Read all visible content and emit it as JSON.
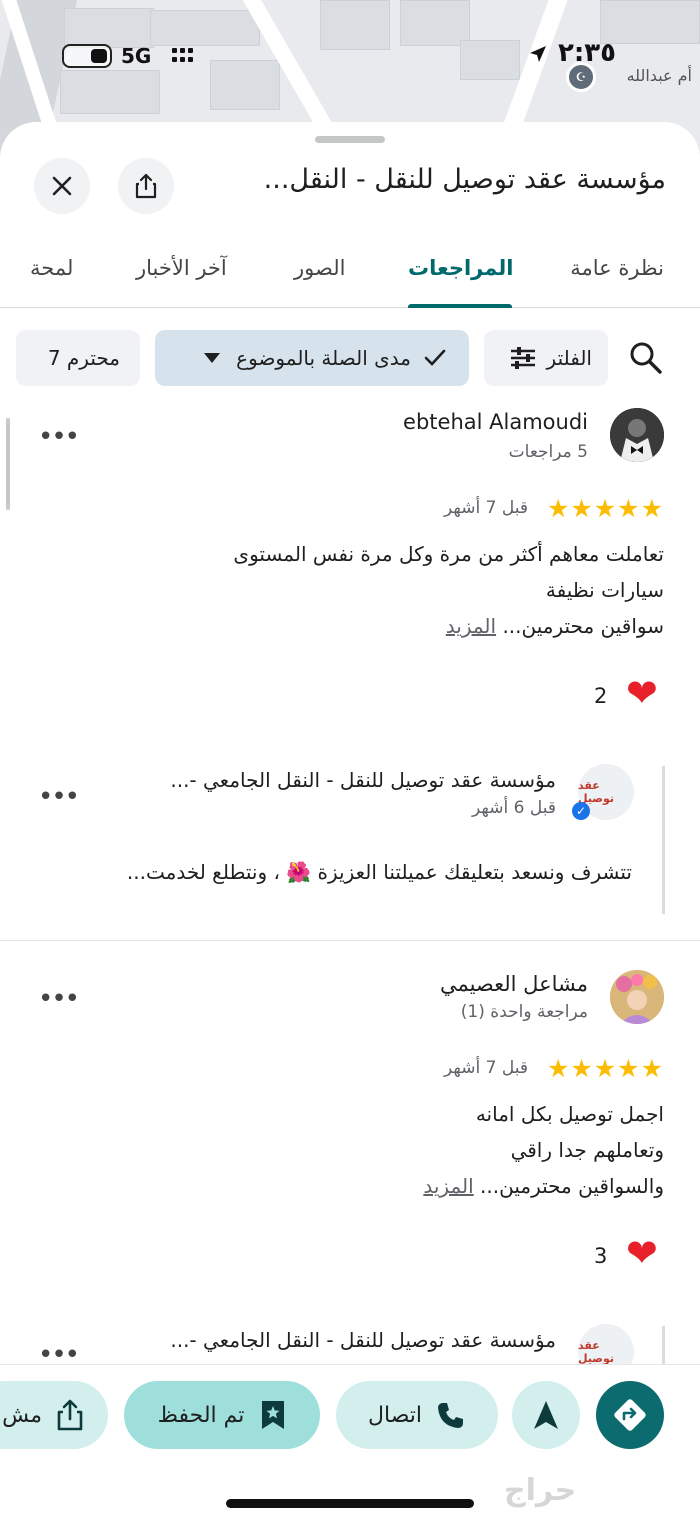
{
  "status_bar": {
    "time": "٢:٣٥",
    "network": "5G"
  },
  "map": {
    "label": "أم عبدالله"
  },
  "place": {
    "title": "مؤسسة عقد توصيل للنقل - النقل..."
  },
  "tabs": [
    {
      "label": "نظرة عامة"
    },
    {
      "label": "المراجعات"
    },
    {
      "label": "الصور"
    },
    {
      "label": "آخر الأخبار"
    },
    {
      "label": "لمحة"
    }
  ],
  "filters": {
    "filter_label": "الفلتر",
    "sort_label": "مدى الصلة بالموضوع",
    "topic_chip": "محترم 7"
  },
  "reviews": [
    {
      "author": "ebtehal Alamoudi",
      "author_meta": "5 مراجعات",
      "rating": 5,
      "stars": "★★★★★",
      "when": "قبل 7 أشهر",
      "lines": [
        "تعاملت معاهم أكثر من مرة وكل مرة نفس المستوى",
        "سيارات نظيفة",
        "سواقين محترمين..."
      ],
      "more_label": "المزيد",
      "likes": "2",
      "owner": {
        "name": "مؤسسة عقد توصيل للنقل - النقل الجامعي -...",
        "when": "قبل 6 أشهر",
        "reply": "تتشرف ونسعد بتعليقك عميلتنا العزيزة 🌺 ، ونتطلع لخدمت..."
      }
    },
    {
      "author": "مشاعل العصيمي",
      "author_meta": "مراجعة واحدة (1)",
      "rating": 5,
      "stars": "★★★★★",
      "when": "قبل 7 أشهر",
      "lines": [
        "اجمل توصيل بكل امانه",
        "وتعاملهم جدا راقي",
        "والسواقين محترمين..."
      ],
      "more_label": "المزيد",
      "likes": "3",
      "owner": {
        "name": "مؤسسة عقد توصيل للنقل - النقل الجامعي -..."
      }
    }
  ],
  "biz_logo_text": "عقد توصيل",
  "actions": {
    "call_label": "اتصال",
    "saved_label": "تم الحفظ",
    "share_partial": "مش"
  },
  "watermark": "حراج",
  "colors": {
    "accent": "#00696b",
    "star": "#fbbc04",
    "heart": "#e8202a",
    "pill": "#d2efee",
    "directions": "#0b6b6e"
  }
}
